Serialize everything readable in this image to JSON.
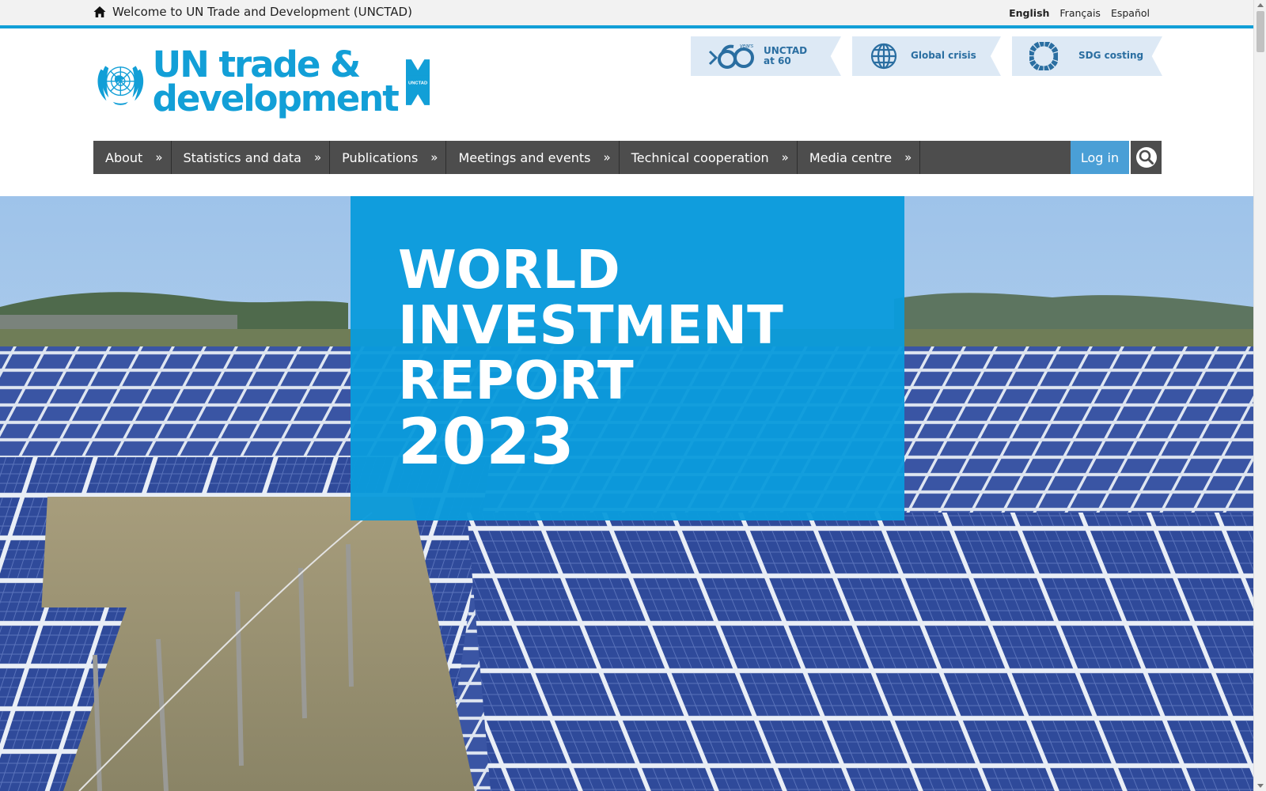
{
  "topbar": {
    "welcome": "Welcome to UN Trade and Development (UNCTAD)",
    "languages": [
      "English",
      "Français",
      "Español"
    ],
    "active_language": "English"
  },
  "header": {
    "logo_line1": "UN trade &",
    "logo_line2": "development",
    "logo_badge": "UNCTAD",
    "promos": [
      {
        "label_line1": "UNCTAD",
        "label_line2": "at 60",
        "icon": "unctad-60-years-icon",
        "icon_text": "years"
      },
      {
        "label_line1": "Global crisis",
        "label_line2": "",
        "icon": "globe-icon"
      },
      {
        "label_line1": "SDG costing",
        "label_line2": "",
        "icon": "sdg-wheel-icon"
      }
    ]
  },
  "nav": {
    "items": [
      "About",
      "Statistics and data",
      "Publications",
      "Meetings and events",
      "Technical cooperation",
      "Media centre"
    ],
    "login": "Log in"
  },
  "hero": {
    "title_lines": [
      "WORLD",
      "INVESTMENT",
      "REPORT"
    ],
    "year": "2023",
    "image": "solar-panels-over-water-photo"
  },
  "colors": {
    "brand_blue": "#129fd7",
    "nav_bg": "#4d4d4d",
    "login_bg": "#4a9fd6",
    "promo_bg": "#dde9f5"
  }
}
